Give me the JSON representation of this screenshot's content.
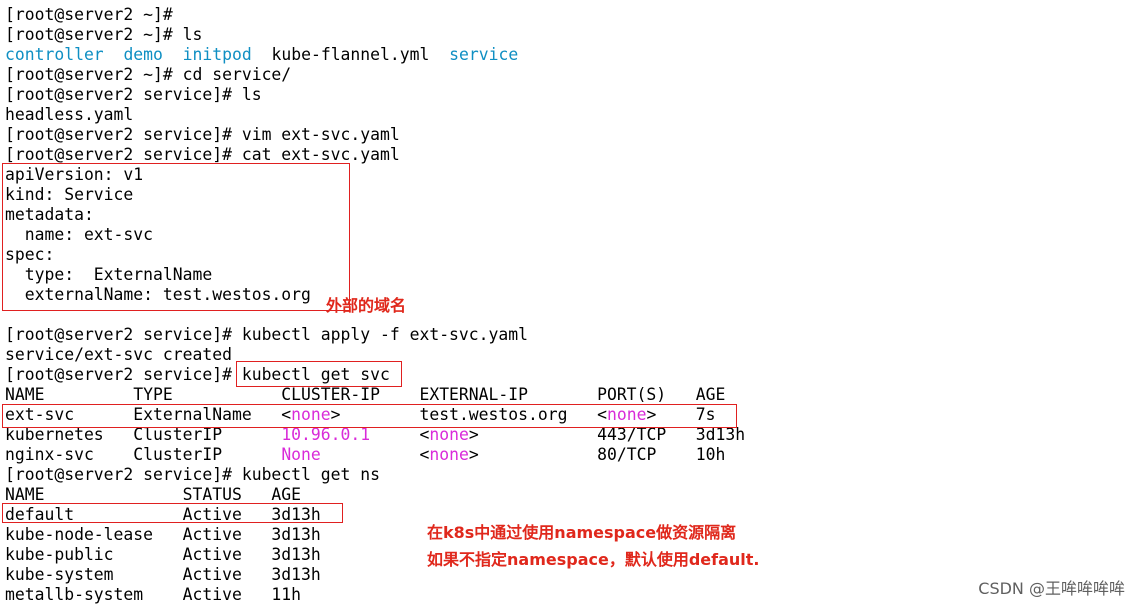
{
  "terminal": {
    "lines": [
      [
        {
          "t": "[root@server2 ~]#"
        }
      ],
      [
        {
          "t": "[root@server2 ~]# ls"
        }
      ],
      [
        {
          "t": "controller",
          "c": "cyan"
        },
        {
          "t": "  "
        },
        {
          "t": "demo",
          "c": "cyan"
        },
        {
          "t": "  "
        },
        {
          "t": "initpod",
          "c": "cyan"
        },
        {
          "t": "  kube-flannel.yml  "
        },
        {
          "t": "service",
          "c": "cyan"
        }
      ],
      [
        {
          "t": "[root@server2 ~]# cd service/"
        }
      ],
      [
        {
          "t": "[root@server2 service]# ls"
        }
      ],
      [
        {
          "t": "headless.yaml"
        }
      ],
      [
        {
          "t": "[root@server2 service]# vim ext-svc.yaml"
        }
      ],
      [
        {
          "t": "[root@server2 service]# cat ext-svc.yaml"
        }
      ],
      [
        {
          "t": "apiVersion: v1"
        }
      ],
      [
        {
          "t": "kind: Service"
        }
      ],
      [
        {
          "t": "metadata:"
        }
      ],
      [
        {
          "t": "  name: ext-svc"
        }
      ],
      [
        {
          "t": "spec:"
        }
      ],
      [
        {
          "t": "  type:  ExternalName"
        }
      ],
      [
        {
          "t": "  externalName: test.westos.org"
        }
      ],
      [],
      [
        {
          "t": "[root@server2 service]# kubectl apply -f ext-svc.yaml"
        }
      ],
      [
        {
          "t": "service/ext-svc created"
        }
      ],
      [
        {
          "t": "[root@server2 service]# kubectl get svc"
        }
      ],
      [
        {
          "t": "NAME         TYPE           CLUSTER-IP    EXTERNAL-IP       PORT(S)   AGE"
        }
      ],
      [
        {
          "t": "ext-svc      ExternalName   <"
        },
        {
          "t": "none",
          "c": "mag"
        },
        {
          "t": ">        test.westos.org   <"
        },
        {
          "t": "none",
          "c": "mag"
        },
        {
          "t": ">    7s"
        }
      ],
      [
        {
          "t": "kubernetes   ClusterIP      "
        },
        {
          "t": "10.96.0.1",
          "c": "mag"
        },
        {
          "t": "     <"
        },
        {
          "t": "none",
          "c": "mag"
        },
        {
          "t": ">            443/TCP   3d13h"
        }
      ],
      [
        {
          "t": "nginx-svc    ClusterIP      "
        },
        {
          "t": "None",
          "c": "mag"
        },
        {
          "t": "          <"
        },
        {
          "t": "none",
          "c": "mag"
        },
        {
          "t": ">            80/TCP    10h"
        }
      ],
      [
        {
          "t": "[root@server2 service]# kubectl get ns"
        }
      ],
      [
        {
          "t": "NAME              STATUS   AGE"
        }
      ],
      [
        {
          "t": "default           Active   3d13h"
        }
      ],
      [
        {
          "t": "kube-node-lease   Active   3d13h"
        }
      ],
      [
        {
          "t": "kube-public       Active   3d13h"
        }
      ],
      [
        {
          "t": "kube-system       Active   3d13h"
        }
      ],
      [
        {
          "t": "metallb-system    Active   11h"
        }
      ]
    ]
  },
  "annotations": {
    "domain_note": "外部的域名",
    "namespace_note_1": "在k8s中通过使用namespace做资源隔离",
    "namespace_note_2": "如果不指定namespace，默认使用default."
  },
  "watermark": "CSDN @王哞哞哞哞",
  "colors": {
    "directory": "#0f8fc3",
    "highlight": "#d92bd9",
    "annotation": "#e0281c",
    "box": "#e02020"
  }
}
